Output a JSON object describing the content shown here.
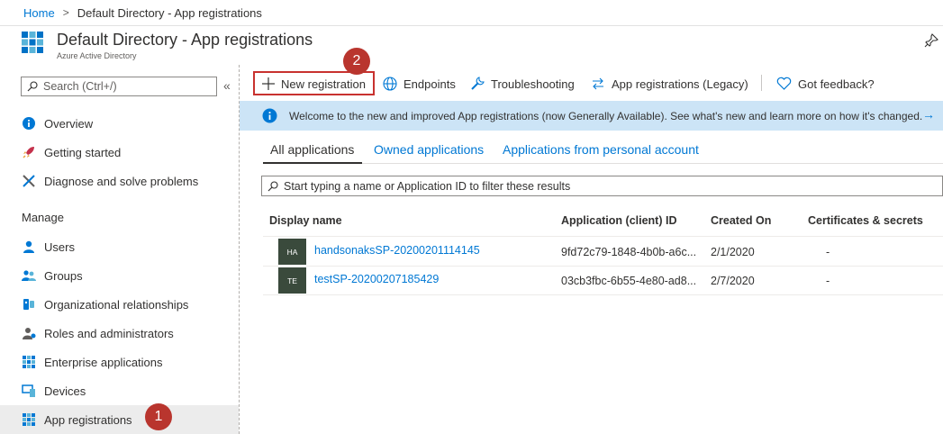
{
  "breadcrumb": {
    "home": "Home",
    "separator": ">",
    "current": "Default Directory - App registrations"
  },
  "header": {
    "title": "Default Directory - App registrations",
    "subtitle": "Azure Active Directory"
  },
  "sidebar": {
    "search_placeholder": "Search (Ctrl+/)",
    "collapse": "«",
    "items_top": [
      {
        "label": "Overview",
        "icon": "info-icon"
      },
      {
        "label": "Getting started",
        "icon": "rocket-icon"
      },
      {
        "label": "Diagnose and solve problems",
        "icon": "wrench-icon"
      }
    ],
    "section_manage": "Manage",
    "items_manage": [
      {
        "label": "Users",
        "icon": "user-icon"
      },
      {
        "label": "Groups",
        "icon": "group-icon"
      },
      {
        "label": "Organizational relationships",
        "icon": "org-relationships-icon"
      },
      {
        "label": "Roles and administrators",
        "icon": "roles-icon"
      },
      {
        "label": "Enterprise applications",
        "icon": "enterprise-apps-icon"
      },
      {
        "label": "Devices",
        "icon": "devices-icon"
      },
      {
        "label": "App registrations",
        "icon": "app-registrations-icon",
        "active": true
      }
    ]
  },
  "badges": {
    "step1": "1",
    "step2": "2"
  },
  "toolbar": {
    "new_registration": "New registration",
    "endpoints": "Endpoints",
    "troubleshooting": "Troubleshooting",
    "legacy": "App registrations (Legacy)",
    "feedback": "Got feedback?"
  },
  "banner": {
    "text": "Welcome to the new and improved App registrations (now Generally Available). See what's new and learn more on how it's changed.",
    "arrow": "→"
  },
  "tabs": [
    "All applications",
    "Owned applications",
    "Applications from personal account"
  ],
  "filter_placeholder": "Start typing a name or Application ID to filter these results",
  "table": {
    "headers": [
      "Display name",
      "Application (client) ID",
      "Created On",
      "Certificates & secrets"
    ],
    "rows": [
      {
        "initials": "HA",
        "name": "handsonaksSP-20200201114145",
        "app_id": "9fd72c79-1848-4b0b-a6c...",
        "created": "2/1/2020",
        "certs": "-"
      },
      {
        "initials": "TE",
        "name": "testSP-20200207185429",
        "app_id": "03cb3fbc-6b55-4e80-ad8...",
        "created": "2/7/2020",
        "certs": "-"
      }
    ]
  },
  "colors": {
    "accent": "#0078d4",
    "banner_bg": "#cce4f6",
    "badge": "#b9352e",
    "avatar": "#3a4a3c"
  }
}
